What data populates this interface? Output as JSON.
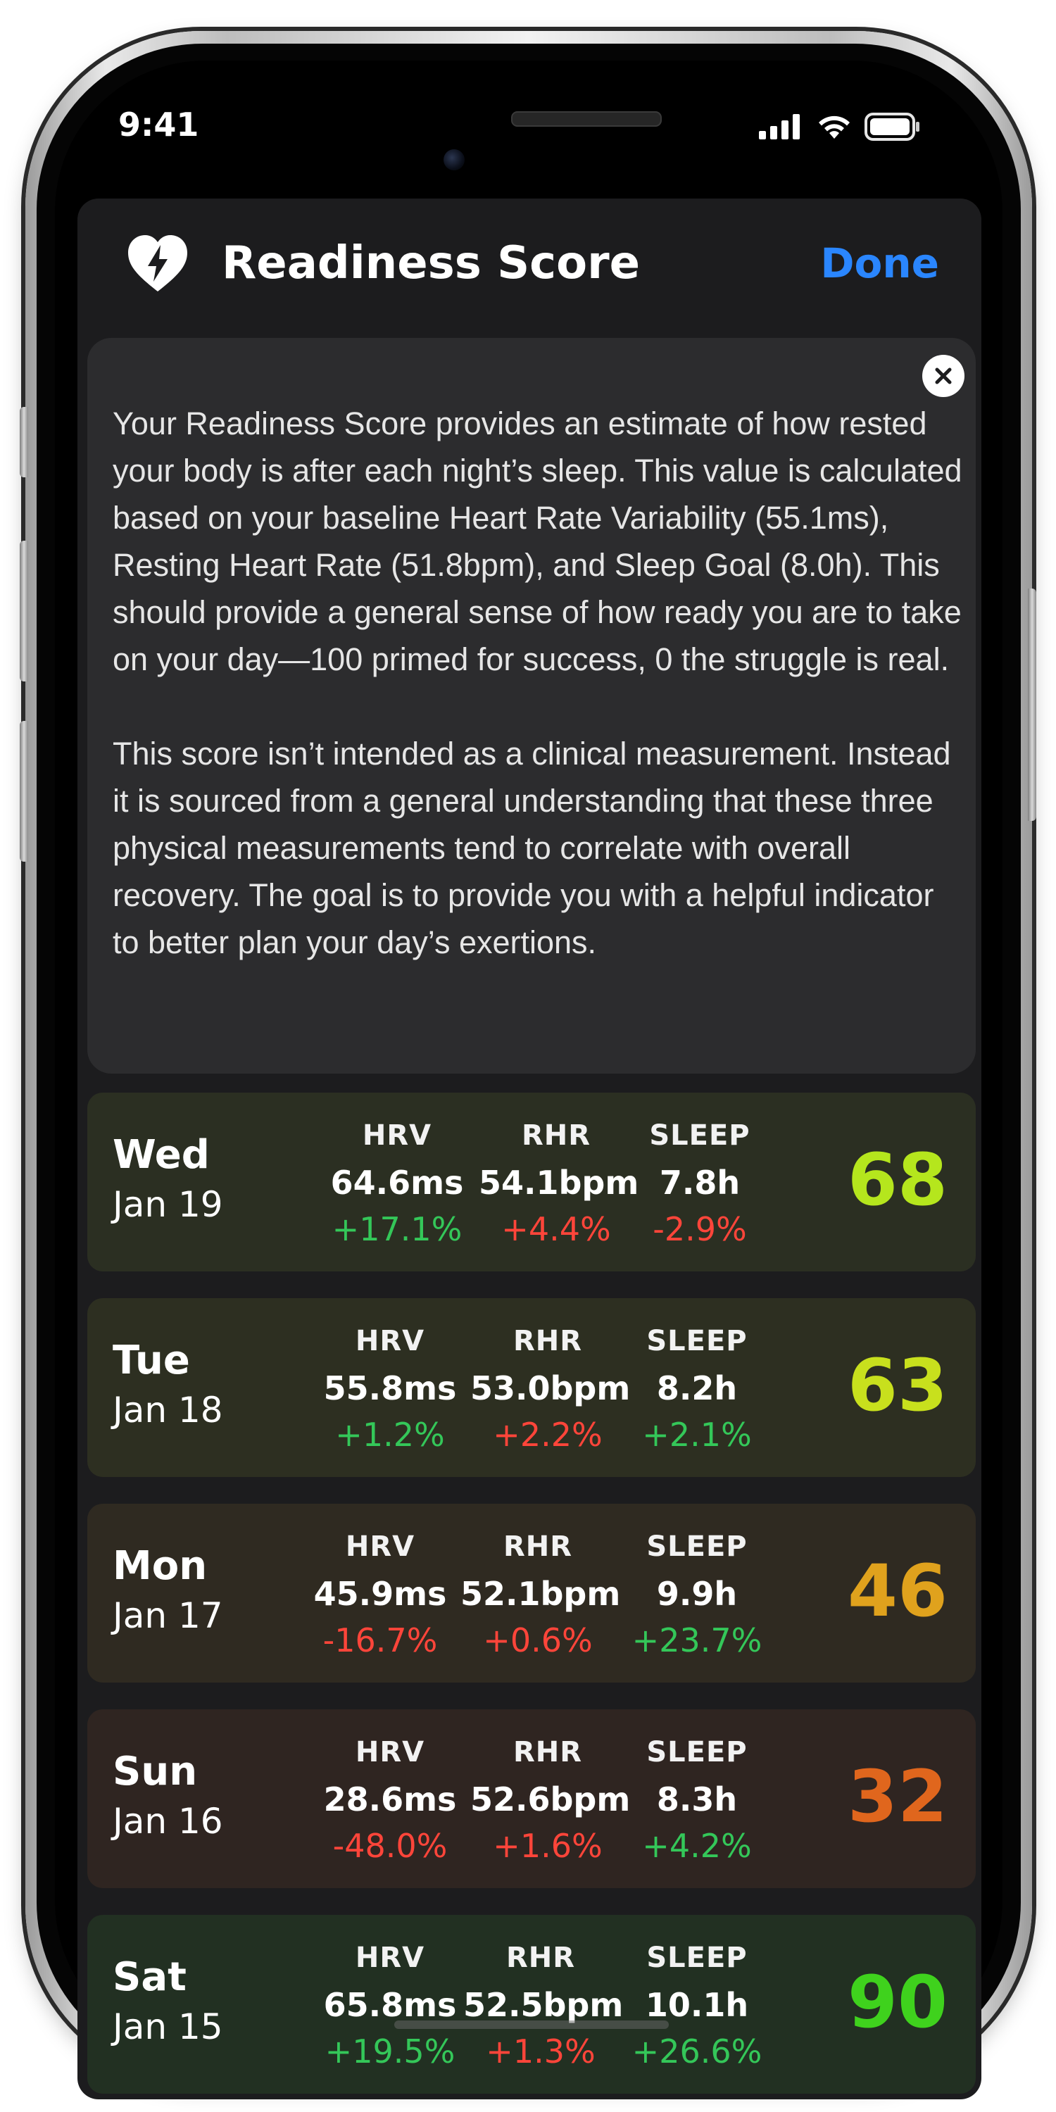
{
  "status_bar": {
    "time": "9:41"
  },
  "header": {
    "title": "Readiness Score",
    "done_label": "Done",
    "icon": "heart-bolt-icon"
  },
  "info": {
    "paragraph1": "Your Readiness Score provides an estimate of how rested your body is after each night’s sleep. This value is calculated based on your baseline Heart Rate Variability (55.1ms), Resting Heart Rate (51.8bpm), and Sleep Goal (8.0h).  This should provide a general sense of how ready you are to take on your day—100 primed for success, 0 the struggle is real.",
    "paragraph2": "This score isn’t intended as a clinical measurement. Instead it is sourced from a general understanding that these three physical measurements tend to correlate with overall recovery.  The goal is to provide you with a helpful indicator to better plan your day’s exertions."
  },
  "metric_labels": {
    "hrv": "HRV",
    "rhr": "RHR",
    "sleep": "SLEEP"
  },
  "days": [
    {
      "day": "Wed",
      "date": "Jan 19",
      "hrv": "64.6ms",
      "hrv_delta": "+17.1%",
      "rhr": "54.1bpm",
      "rhr_delta": "+4.4%",
      "sleep": "7.8h",
      "sleep_delta": "-2.9%",
      "score": "68",
      "score_color": "#b5e61d",
      "bg": "#2b2f22"
    },
    {
      "day": "Tue",
      "date": "Jan 18",
      "hrv": "55.8ms",
      "hrv_delta": "+1.2%",
      "rhr": "53.0bpm",
      "rhr_delta": "+2.2%",
      "sleep": "8.2h",
      "sleep_delta": "+2.1%",
      "score": "63",
      "score_color": "#c8e01d",
      "bg": "#2d2f21"
    },
    {
      "day": "Mon",
      "date": "Jan 17",
      "hrv": "45.9ms",
      "hrv_delta": "-16.7%",
      "rhr": "52.1bpm",
      "rhr_delta": "+0.6%",
      "sleep": "9.9h",
      "sleep_delta": "+23.7%",
      "score": "46",
      "score_color": "#e0a21d",
      "bg": "#2f2a21"
    },
    {
      "day": "Sun",
      "date": "Jan 16",
      "hrv": "28.6ms",
      "hrv_delta": "-48.0%",
      "rhr": "52.6bpm",
      "rhr_delta": "+1.6%",
      "sleep": "8.3h",
      "sleep_delta": "+4.2%",
      "score": "32",
      "score_color": "#e0661d",
      "bg": "#2f2521"
    },
    {
      "day": "Sat",
      "date": "Jan 15",
      "hrv": "65.8ms",
      "hrv_delta": "+19.5%",
      "rhr": "52.5bpm",
      "rhr_delta": "+1.3%",
      "sleep": "10.1h",
      "sleep_delta": "+26.6%",
      "score": "90",
      "score_color": "#3fd21d",
      "bg": "#223022"
    }
  ],
  "colors": {
    "positive": "#34c759",
    "negative": "#ff453a",
    "accent": "#2a86ff"
  }
}
